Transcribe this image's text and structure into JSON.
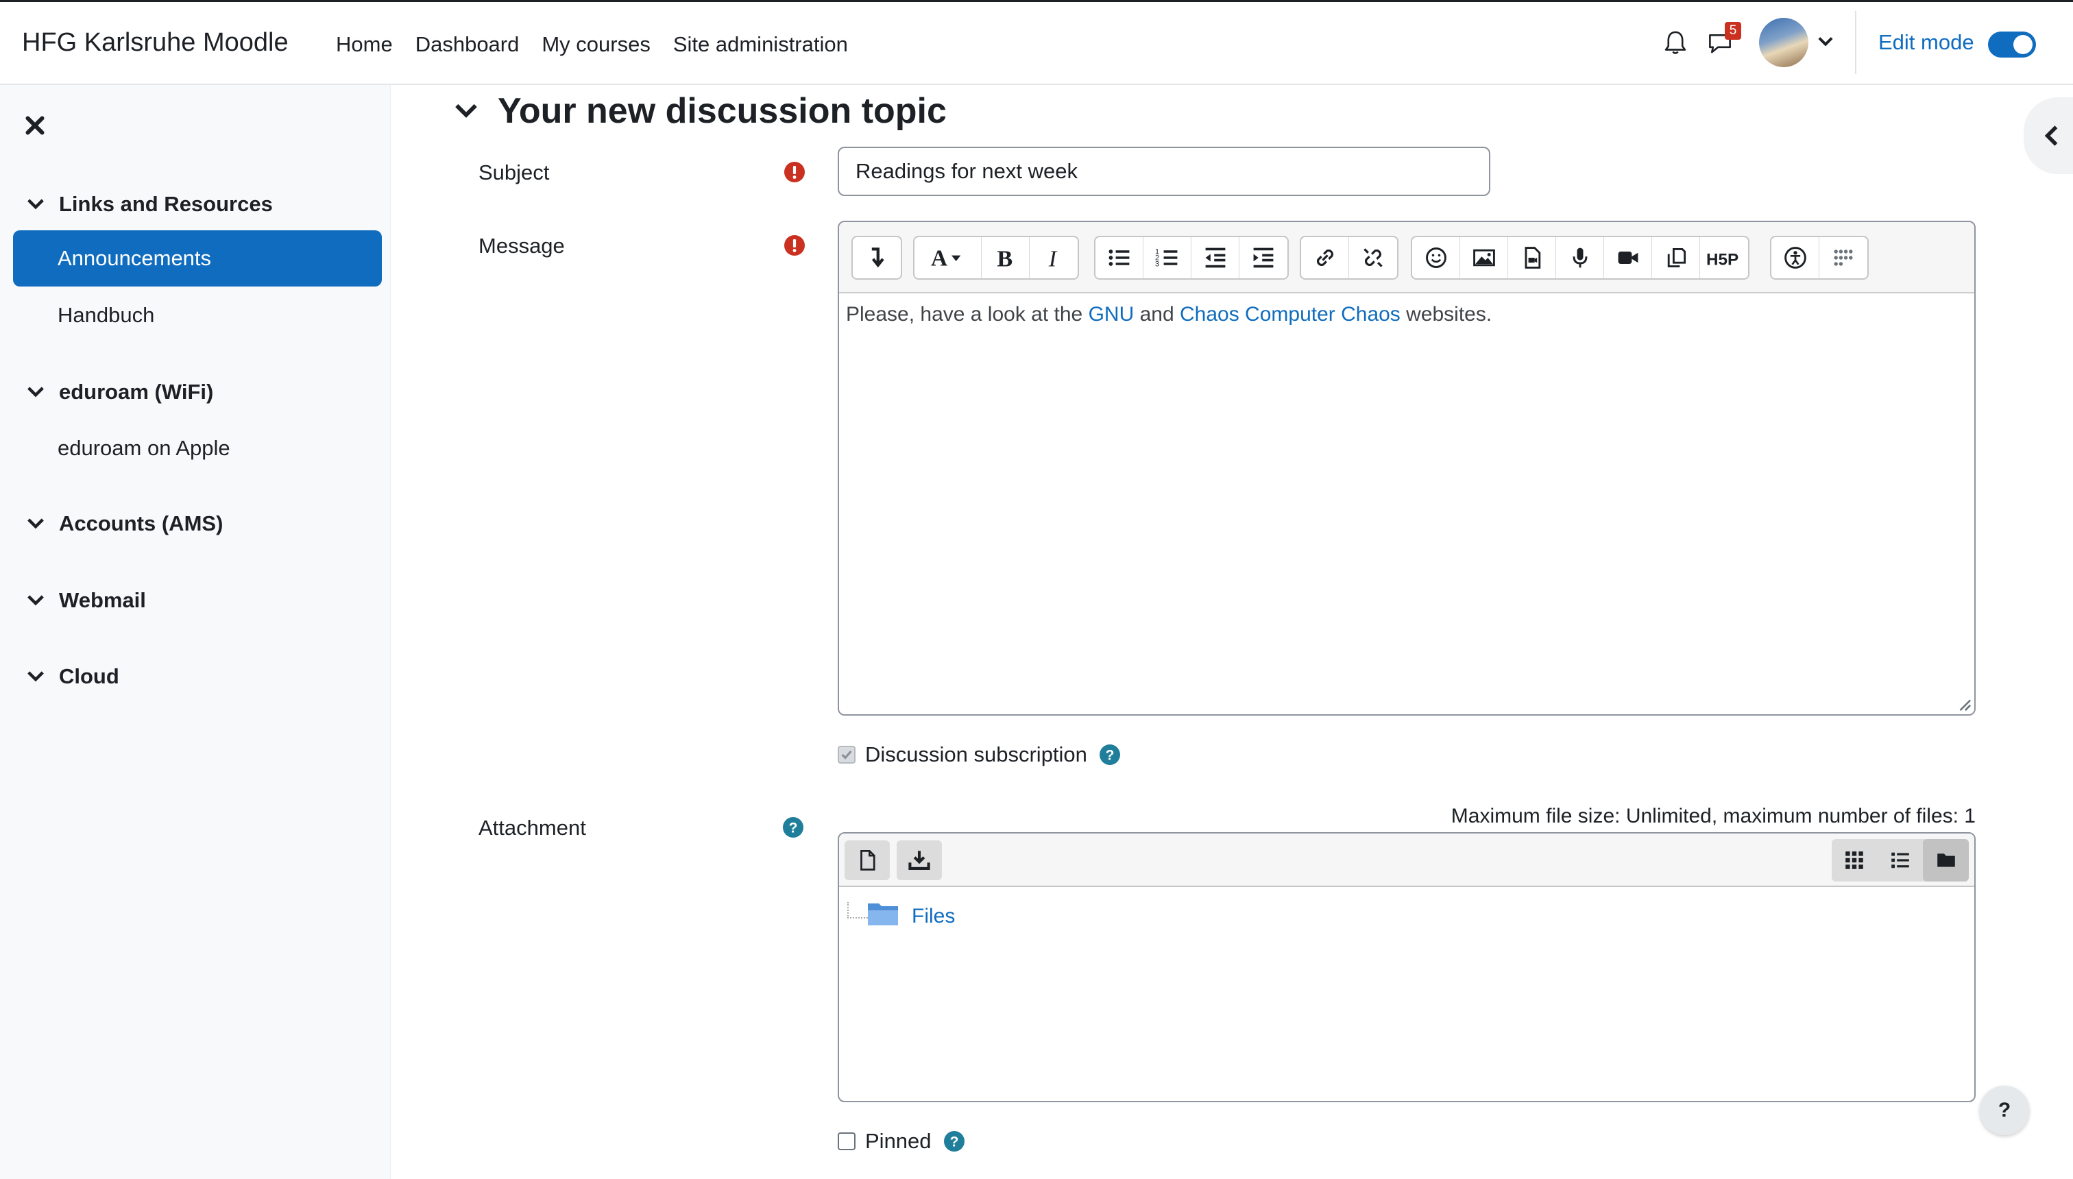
{
  "navbar": {
    "brand": "HFG Karlsruhe Moodle",
    "links": [
      "Home",
      "Dashboard",
      "My courses",
      "Site administration"
    ],
    "message_badge": "5",
    "edit_mode_label": "Edit mode",
    "edit_mode_on": true,
    "accent": "#0f6cbf"
  },
  "drawer": {
    "sections": [
      {
        "title": "Links and Resources",
        "items": [
          "Announcements",
          "Handbuch"
        ]
      },
      {
        "title": "eduroam (WiFi)",
        "items": [
          "eduroam on Apple"
        ]
      },
      {
        "title": "Accounts (AMS)",
        "items": []
      },
      {
        "title": "Webmail",
        "items": []
      },
      {
        "title": "Cloud",
        "items": []
      }
    ],
    "active_item": "Announcements"
  },
  "form": {
    "title": "Your new discussion topic",
    "subject_label": "Subject",
    "subject_value": "Readings for next week",
    "message_label": "Message",
    "message": {
      "before_link1": "Please, have a look at the ",
      "link1": "GNU",
      "between": " and ",
      "link2": "Chaos Computer Chaos",
      "after": " websites."
    },
    "subscription_label": "Discussion subscription",
    "attachment_label": "Attachment",
    "max_size_text": "Maximum file size: Unlimited, maximum number of files: 1",
    "files_folder": "Files",
    "pinned_label": "Pinned",
    "help_fab": "?"
  },
  "colors": {
    "required": "#ca3120",
    "help": "#1f7e9a",
    "link": "#0f6cbf"
  }
}
